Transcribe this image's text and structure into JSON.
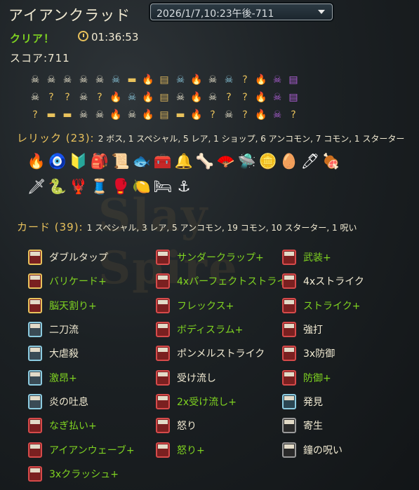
{
  "header": {
    "title": "アイアンクラッド",
    "run_select": "2026/1/7,10:23午後-711",
    "clear_label": "クリア！",
    "time": "01:36:53",
    "score": "スコア:711"
  },
  "map_rows": [
    [
      "skull",
      "skull",
      "skull",
      "skull",
      "skull",
      "elite",
      "gold",
      "fire",
      "chest",
      "elite",
      "fire",
      "skull",
      "elite",
      "?",
      "fire",
      "boss",
      "shop"
    ],
    [
      "skull",
      "?",
      "?",
      "skull",
      "?",
      "fire",
      "elite",
      "fire",
      "chest",
      "skull",
      "fire",
      "skull",
      "?",
      "?",
      "fire",
      "boss",
      "shop"
    ],
    [
      "?",
      "gold",
      "gold",
      "skull",
      "skull",
      "fire",
      "skull",
      "fire",
      "chest",
      "gold",
      "fire",
      "?",
      "skull",
      "?",
      "fire",
      "boss",
      "?"
    ]
  ],
  "relics": {
    "title": "レリック (23):",
    "summary": "2 ボス, 1 スペシャル, 5 レア, 1 ショップ, 6 アンコモン, 7 コモン, 1 スターター",
    "row1": [
      "🔥",
      "🧿",
      "🔰",
      "🎒",
      "📜",
      "🐟",
      "🧰",
      "🔔",
      "🦴",
      "🪭",
      "🛸",
      "🪙",
      "🥚",
      "🖊",
      "🍖"
    ],
    "row2": [
      "🗡",
      "🐍",
      "🦞",
      "🧵",
      "🥊",
      "🍋",
      "🛏",
      "⚓"
    ]
  },
  "cards": {
    "title": "カード (39):",
    "summary": "1 スペシャル, 3 レア, 5 アンコモン, 19 コモン, 10 スターター, 1 呪い",
    "col1": [
      {
        "name": "ダブルタップ",
        "up": false,
        "kind": "power"
      },
      {
        "name": "バリケード+",
        "up": true,
        "kind": "power"
      },
      {
        "name": "脳天割り+",
        "up": true,
        "kind": "power"
      },
      {
        "name": "二刀流",
        "up": false,
        "kind": "status"
      },
      {
        "name": "大虐殺",
        "up": false,
        "kind": "status"
      },
      {
        "name": "激昂+",
        "up": true,
        "kind": "status"
      },
      {
        "name": "炎の吐息",
        "up": false,
        "kind": "status"
      },
      {
        "name": "なぎ払い+",
        "up": true,
        "kind": "skill"
      },
      {
        "name": "アイアンウェーブ+",
        "up": true,
        "kind": "skill"
      },
      {
        "name": "3xクラッシュ+",
        "up": true,
        "kind": "skill"
      }
    ],
    "col2": [
      {
        "name": "サンダークラップ+",
        "up": true,
        "kind": "skill"
      },
      {
        "name": "4xパーフェクトストライク",
        "up": true,
        "kind": "skill"
      },
      {
        "name": "フレックス+",
        "up": true,
        "kind": "skill"
      },
      {
        "name": "ボディスラム+",
        "up": true,
        "kind": "skill"
      },
      {
        "name": "ポンメルストライク",
        "up": false,
        "kind": "skill"
      },
      {
        "name": "受け流し",
        "up": false,
        "kind": "skill"
      },
      {
        "name": "2x受け流し+",
        "up": true,
        "kind": "skill"
      },
      {
        "name": "怒り",
        "up": false,
        "kind": "skill"
      },
      {
        "name": "怒り+",
        "up": true,
        "kind": "skill"
      }
    ],
    "col3": [
      {
        "name": "武装+",
        "up": true,
        "kind": "skill"
      },
      {
        "name": "4xストライク",
        "up": false,
        "kind": "skill"
      },
      {
        "name": "ストライク+",
        "up": true,
        "kind": "skill"
      },
      {
        "name": "強打",
        "up": false,
        "kind": "skill"
      },
      {
        "name": "3x防御",
        "up": false,
        "kind": "skill"
      },
      {
        "name": "防御+",
        "up": true,
        "kind": "skill"
      },
      {
        "name": "発見",
        "up": false,
        "kind": "special"
      },
      {
        "name": "寄生",
        "up": false,
        "kind": "curse"
      },
      {
        "name": "鐘の呪い",
        "up": false,
        "kind": "curse"
      }
    ]
  },
  "colors": {
    "gold": "#e9c25c",
    "upgrade": "#7fd321",
    "text": "#f1ead2"
  }
}
